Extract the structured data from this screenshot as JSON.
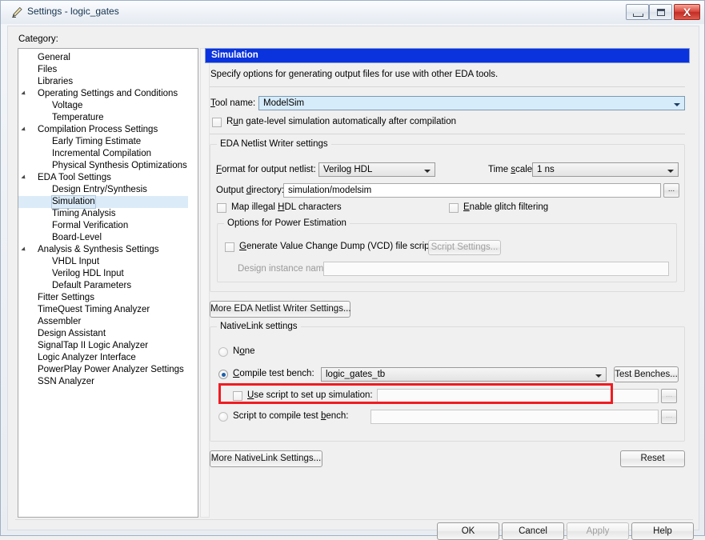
{
  "window": {
    "title": "Settings - logic_gates",
    "icon": "pencil-icon",
    "minimize_label": "Minimize",
    "maximize_label": "Maximize",
    "close_label": "X"
  },
  "category": {
    "label": "Category:",
    "selected": "Simulation",
    "items": [
      {
        "label": "General",
        "depth": 0,
        "expandable": false
      },
      {
        "label": "Files",
        "depth": 0,
        "expandable": false
      },
      {
        "label": "Libraries",
        "depth": 0,
        "expandable": false
      },
      {
        "label": "Operating Settings and Conditions",
        "depth": 0,
        "expandable": true
      },
      {
        "label": "Voltage",
        "depth": 1,
        "expandable": false
      },
      {
        "label": "Temperature",
        "depth": 1,
        "expandable": false
      },
      {
        "label": "Compilation Process Settings",
        "depth": 0,
        "expandable": true
      },
      {
        "label": "Early Timing Estimate",
        "depth": 1,
        "expandable": false
      },
      {
        "label": "Incremental Compilation",
        "depth": 1,
        "expandable": false
      },
      {
        "label": "Physical Synthesis Optimizations",
        "depth": 1,
        "expandable": false
      },
      {
        "label": "EDA Tool Settings",
        "depth": 0,
        "expandable": true
      },
      {
        "label": "Design Entry/Synthesis",
        "depth": 1,
        "expandable": false
      },
      {
        "label": "Simulation",
        "depth": 1,
        "expandable": false,
        "selected": true
      },
      {
        "label": "Timing Analysis",
        "depth": 1,
        "expandable": false
      },
      {
        "label": "Formal Verification",
        "depth": 1,
        "expandable": false
      },
      {
        "label": "Board-Level",
        "depth": 1,
        "expandable": false
      },
      {
        "label": "Analysis & Synthesis Settings",
        "depth": 0,
        "expandable": true
      },
      {
        "label": "VHDL Input",
        "depth": 1,
        "expandable": false
      },
      {
        "label": "Verilog HDL Input",
        "depth": 1,
        "expandable": false
      },
      {
        "label": "Default Parameters",
        "depth": 1,
        "expandable": false
      },
      {
        "label": "Fitter Settings",
        "depth": 0,
        "expandable": false
      },
      {
        "label": "TimeQuest Timing Analyzer",
        "depth": 0,
        "expandable": false
      },
      {
        "label": "Assembler",
        "depth": 0,
        "expandable": false
      },
      {
        "label": "Design Assistant",
        "depth": 0,
        "expandable": false
      },
      {
        "label": "SignalTap II Logic Analyzer",
        "depth": 0,
        "expandable": false
      },
      {
        "label": "Logic Analyzer Interface",
        "depth": 0,
        "expandable": false
      },
      {
        "label": "PowerPlay Power Analyzer Settings",
        "depth": 0,
        "expandable": false
      },
      {
        "label": "SSN Analyzer",
        "depth": 0,
        "expandable": false
      }
    ]
  },
  "panel": {
    "header": "Simulation",
    "description": "Specify options for generating output files for use with other EDA tools.",
    "tool_name_label": "Tool name:",
    "tool_name_value": "ModelSim",
    "run_gate_level_label": "Run gate-level simulation automatically after compilation",
    "run_gate_level_checked": false
  },
  "netlist_writer": {
    "group_title": "EDA Netlist Writer settings",
    "format_label": "Format for output netlist:",
    "format_value": "Verilog HDL",
    "time_scale_label": "Time scale:",
    "time_scale_value": "1 ns",
    "output_dir_label": "Output directory:",
    "output_dir_value": "simulation/modelsim",
    "browse_label": "...",
    "map_illegal_label": "Map illegal HDL characters",
    "map_illegal_checked": false,
    "glitch_label": "Enable glitch filtering",
    "glitch_checked": false,
    "power_group_title": "Options for Power Estimation",
    "vcd_label": "Generate Value Change Dump (VCD) file script",
    "vcd_checked": false,
    "script_settings_button": "Script Settings...",
    "design_instance_label": "Design instance name:",
    "design_instance_value": ""
  },
  "nativelink": {
    "more_eda_button": "More EDA Netlist Writer Settings...",
    "group_title": "NativeLink settings",
    "none_label": "None",
    "none_selected": false,
    "compile_tb_label": "Compile test bench:",
    "compile_tb_selected": true,
    "compile_tb_value": "logic_gates_tb",
    "test_benches_button": "Test Benches...",
    "use_script_label": "Use script to set up simulation:",
    "use_script_checked": false,
    "use_script_value": "",
    "script_compile_label": "Script to compile test bench:",
    "script_compile_selected": false,
    "script_compile_value": "",
    "browse_label": "...",
    "more_nativelink_button": "More NativeLink Settings...",
    "reset_button": "Reset"
  },
  "footer": {
    "ok": "OK",
    "cancel": "Cancel",
    "apply": "Apply",
    "apply_enabled": false,
    "help": "Help"
  },
  "colors": {
    "header_blue": "#0a32dd",
    "highlight_red": "#ef1c22",
    "selection_blue": "#dcebf8",
    "combo_blue": "#d7ecfa"
  }
}
